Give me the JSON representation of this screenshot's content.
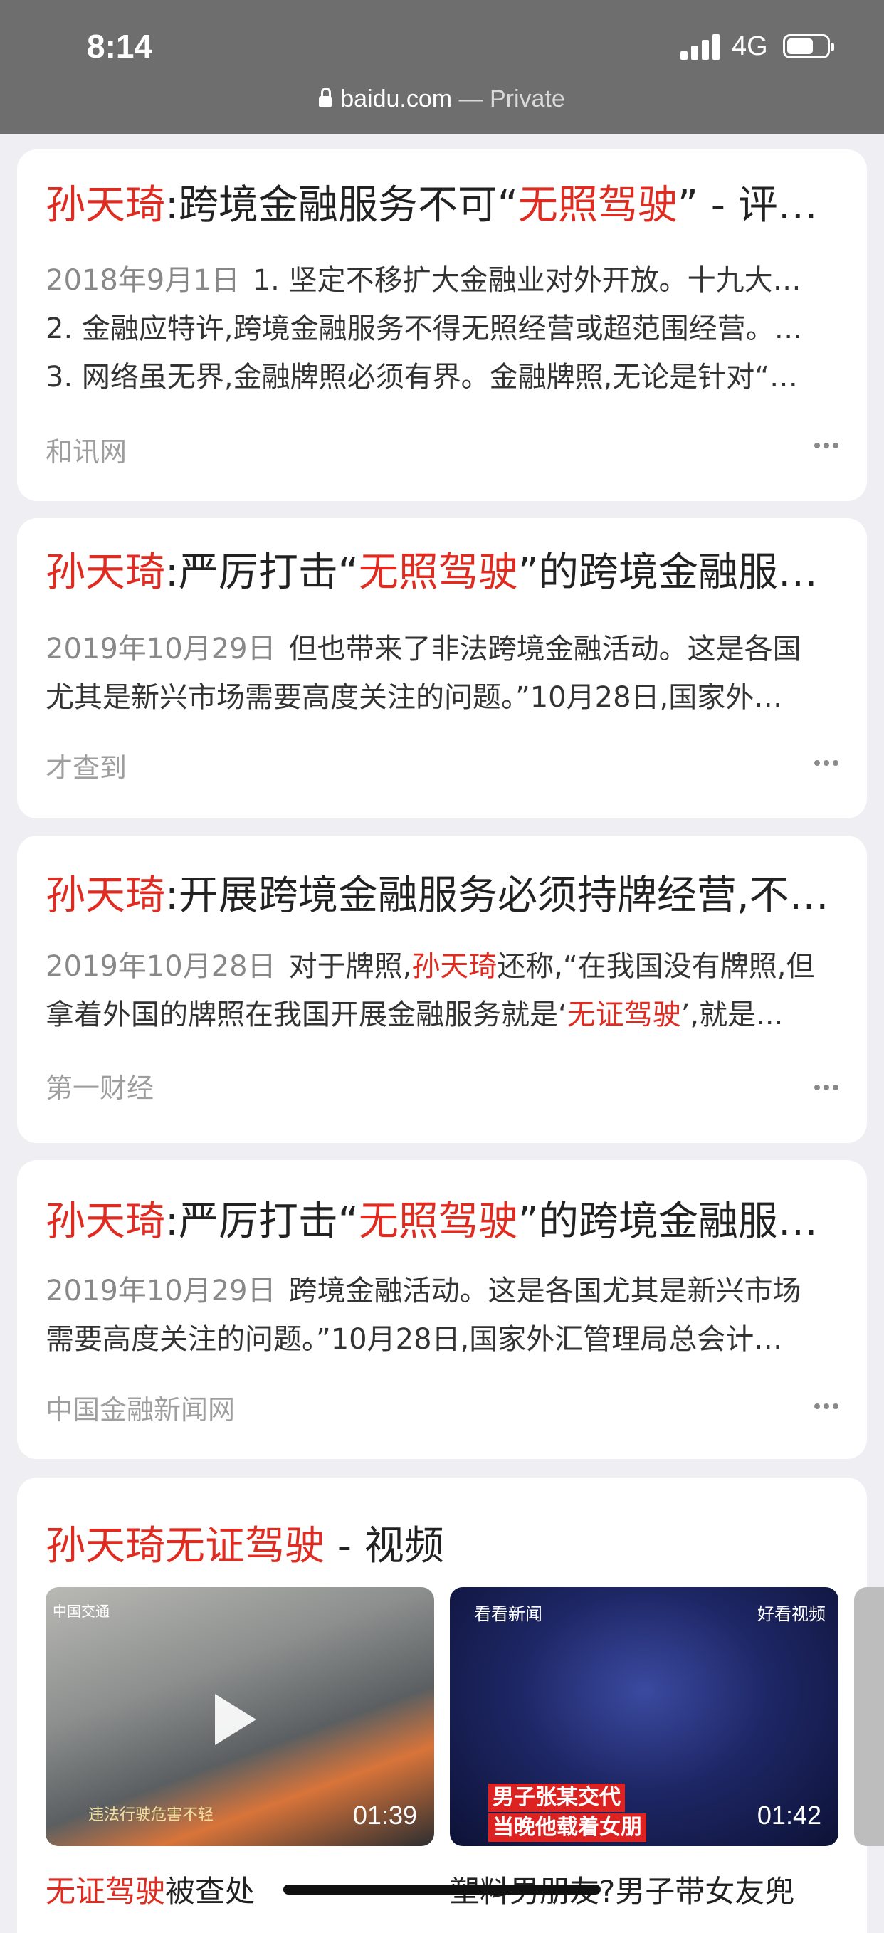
{
  "status_bar": {
    "time": "8:14",
    "network": "4G"
  },
  "address": {
    "domain": "baidu.com",
    "suffix": " — Private"
  },
  "results": [
    {
      "title": [
        {
          "t": "孙天琦",
          "hl": true
        },
        {
          "t": ":跨境金融服务不可“",
          "hl": false
        },
        {
          "t": "无照驾驶",
          "hl": true
        },
        {
          "t": "” - 评…",
          "hl": false
        }
      ],
      "date": "2018年9月1日",
      "lines": [
        "1. 坚定不移扩大金融业对外开放。十九大…",
        "2. 金融应特许,跨境金融服务不得无照经营或超范围经营。…",
        "3. 网络虽无界,金融牌照必须有界。金融牌照,无论是针对“…"
      ],
      "source": "和讯网"
    },
    {
      "title": [
        {
          "t": "孙天琦",
          "hl": true
        },
        {
          "t": ":严厉打击“",
          "hl": false
        },
        {
          "t": "无照驾驶",
          "hl": true
        },
        {
          "t": "”的跨境金融服…",
          "hl": false
        }
      ],
      "date": "2019年10月29日",
      "lines": [
        "但也带来了非法跨境金融活动。这是各国",
        "尤其是新兴市场需要高度关注的问题。”10月28日,国家外…"
      ],
      "source": "才查到"
    },
    {
      "title": [
        {
          "t": "孙天琦",
          "hl": true
        },
        {
          "t": ":开展跨境金融服务必须持牌经营,不…",
          "hl": false
        }
      ],
      "date": "2019年10月28日",
      "lines_rich": [
        [
          {
            "t": "对于牌照,",
            "hl": false
          },
          {
            "t": "孙天琦",
            "hl": true
          },
          {
            "t": "还称,“在我国没有牌照,但",
            "hl": false
          }
        ],
        [
          {
            "t": "拿着外国的牌照在我国开展金融服务就是‘",
            "hl": false
          },
          {
            "t": "无证驾驶",
            "hl": true
          },
          {
            "t": "’,就是...",
            "hl": false
          }
        ]
      ],
      "source": "第一财经"
    },
    {
      "title": [
        {
          "t": "孙天琦",
          "hl": true
        },
        {
          "t": ":严厉打击“",
          "hl": false
        },
        {
          "t": "无照驾驶",
          "hl": true
        },
        {
          "t": "”的跨境金融服…",
          "hl": false
        }
      ],
      "date": "2019年10月29日",
      "lines": [
        "跨境金融活动。这是各国尤其是新兴市场",
        "需要高度关注的问题。”10月28日,国家外汇管理局总会计…"
      ],
      "source": "中国金融新闻网"
    }
  ],
  "video_section": {
    "title_hl": "孙天琦无证驾驶",
    "title_rest": " - 视频",
    "videos": [
      {
        "duration": "01:39",
        "caption_hl": "无证驾驶",
        "caption_rest": "被查处",
        "watermark": "中国交通",
        "subtitle": "违法行驶危害不轻"
      },
      {
        "duration": "01:42",
        "caption_rest": "塑料男朋友?男子带女友兜",
        "watermark_left": "看看新闻",
        "watermark_right": "好看视频",
        "banner_1": "男子张某交代",
        "banner_2": "当晚他载着女朋"
      }
    ]
  }
}
